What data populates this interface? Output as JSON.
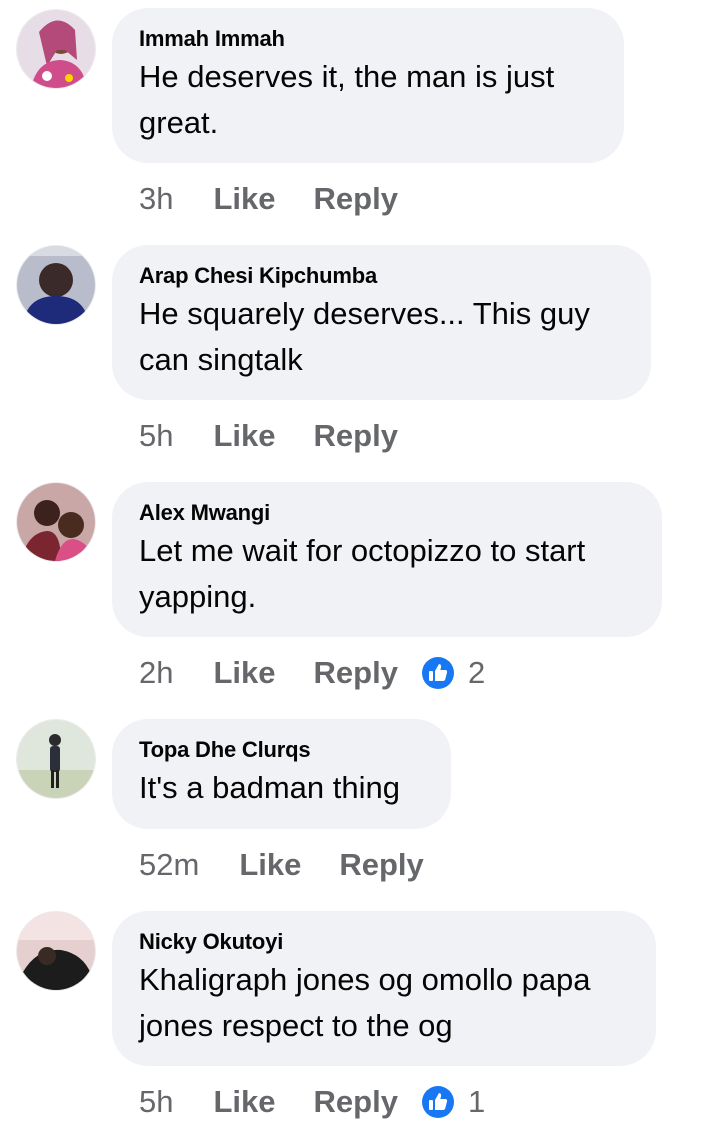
{
  "comments": [
    {
      "author": "Immah Immah",
      "lines": [
        "He deserves it,  the man is just",
        "great."
      ],
      "time": "3h",
      "like_label": "Like",
      "reply_label": "Reply",
      "reactions": null
    },
    {
      "author": "Arap Chesi Kipchumba",
      "lines": [
        "He squarely deserves... This guy",
        "can singtalk"
      ],
      "time": "5h",
      "like_label": "Like",
      "reply_label": "Reply",
      "reactions": null
    },
    {
      "author": "Alex Mwangi",
      "lines": [
        "Let me wait for octopizzo to start",
        "yapping."
      ],
      "time": "2h",
      "like_label": "Like",
      "reply_label": "Reply",
      "reactions": "2"
    },
    {
      "author": "Topa Dhe Clurqs",
      "lines": [
        "It's a badman thing"
      ],
      "time": "52m",
      "like_label": "Like",
      "reply_label": "Reply",
      "reactions": null
    },
    {
      "author": "Nicky Okutoyi",
      "lines": [
        "Khaligraph jones og omollo papa",
        "jones respect to the og"
      ],
      "time": "5h",
      "like_label": "Like",
      "reply_label": "Reply",
      "reactions": "1"
    }
  ],
  "icons": {
    "reaction": "like-thumbs-up-icon"
  },
  "colors": {
    "bubble": "#f0f2f5",
    "meta_text": "#65676b",
    "like_blue": "#1877f2"
  }
}
